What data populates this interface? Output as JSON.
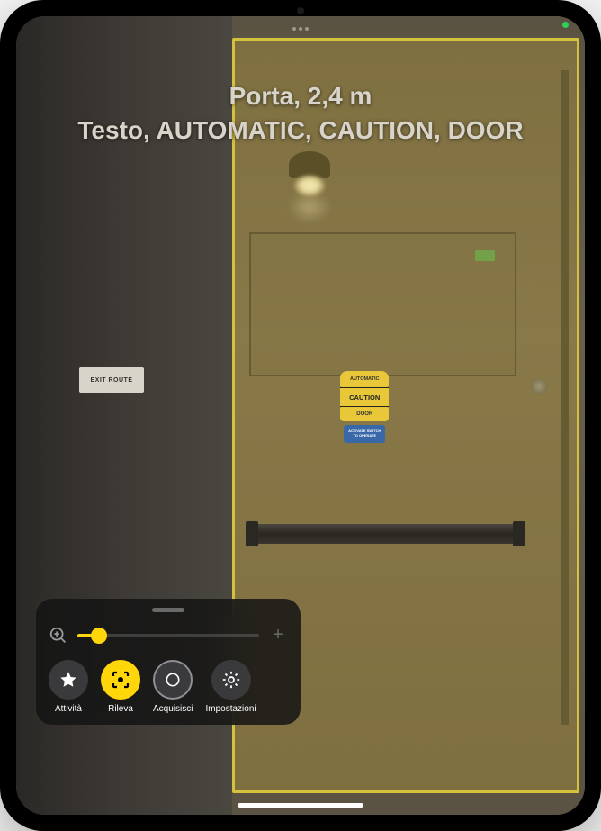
{
  "status": {
    "privacy_indicator": "camera-active"
  },
  "detection": {
    "line1": "Porta, 2,4 m",
    "line2": "Testo, AUTOMATIC, CAUTION, DOOR",
    "highlight_color": "#d4c23c"
  },
  "scene": {
    "exit_route_label": "EXIT ROUTE",
    "caution_sign": {
      "top": "AUTOMATIC",
      "middle": "CAUTION",
      "bottom": "DOOR",
      "blue_top": "ACTIVATE SWITCH",
      "blue_bottom": "TO OPERATE"
    }
  },
  "controls": {
    "zoom": {
      "value_percent": 12,
      "min_icon": "zoom-out",
      "max_icon": "plus"
    },
    "buttons": [
      {
        "id": "activities",
        "label": "Attività",
        "icon": "star",
        "style": "dark"
      },
      {
        "id": "detect",
        "label": "Rileva",
        "icon": "detect",
        "style": "yellow"
      },
      {
        "id": "capture",
        "label": "Acquisisci",
        "icon": "circle",
        "style": "outlined"
      },
      {
        "id": "settings",
        "label": "Impostazioni",
        "icon": "gear",
        "style": "dark"
      }
    ]
  }
}
